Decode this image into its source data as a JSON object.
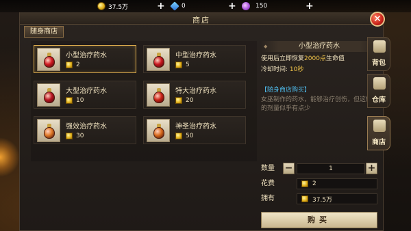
{
  "currency": {
    "gold": "37.5万",
    "gem": "0",
    "crystal": "150"
  },
  "panel": {
    "title": "商店",
    "subtab": "随身商店"
  },
  "items": [
    {
      "name": "小型治疗药水",
      "price": "2",
      "liquid": "#d01a22"
    },
    {
      "name": "中型治疗药水",
      "price": "5",
      "liquid": "#c8161f"
    },
    {
      "name": "大型治疗药水",
      "price": "10",
      "liquid": "#b81522"
    },
    {
      "name": "特大治疗药水",
      "price": "20",
      "liquid": "#cc2418"
    },
    {
      "name": "强效治疗药水",
      "price": "30",
      "liquid": "#e07a28"
    },
    {
      "name": "神圣治疗药水",
      "price": "50",
      "liquid": "#d86a1c"
    }
  ],
  "detail": {
    "title": "小型治疗药水",
    "use_prefix": "使用后立即恢复",
    "use_amount": "2000点",
    "use_suffix": "生命值",
    "cooldown_label": "冷却时间:",
    "cooldown_value": "10秒",
    "shop_head": "【随身商店购买】",
    "desc": "女巫制作的药水，能够治疗创伤，但这瓶的剂量似乎有点少"
  },
  "purchase": {
    "qty_label": "数量",
    "qty_value": "1",
    "minus": "−",
    "plus": "+",
    "cost_label": "花费",
    "cost_value": "2",
    "own_label": "拥有",
    "own_value": "37.5万",
    "buy_label": "购买"
  },
  "side_tabs": [
    "背包",
    "仓库",
    "商店"
  ],
  "colors": {
    "accent_gold": "#d9a94c",
    "close_red": "#c8231a",
    "info_blue": "#4db7e6"
  }
}
